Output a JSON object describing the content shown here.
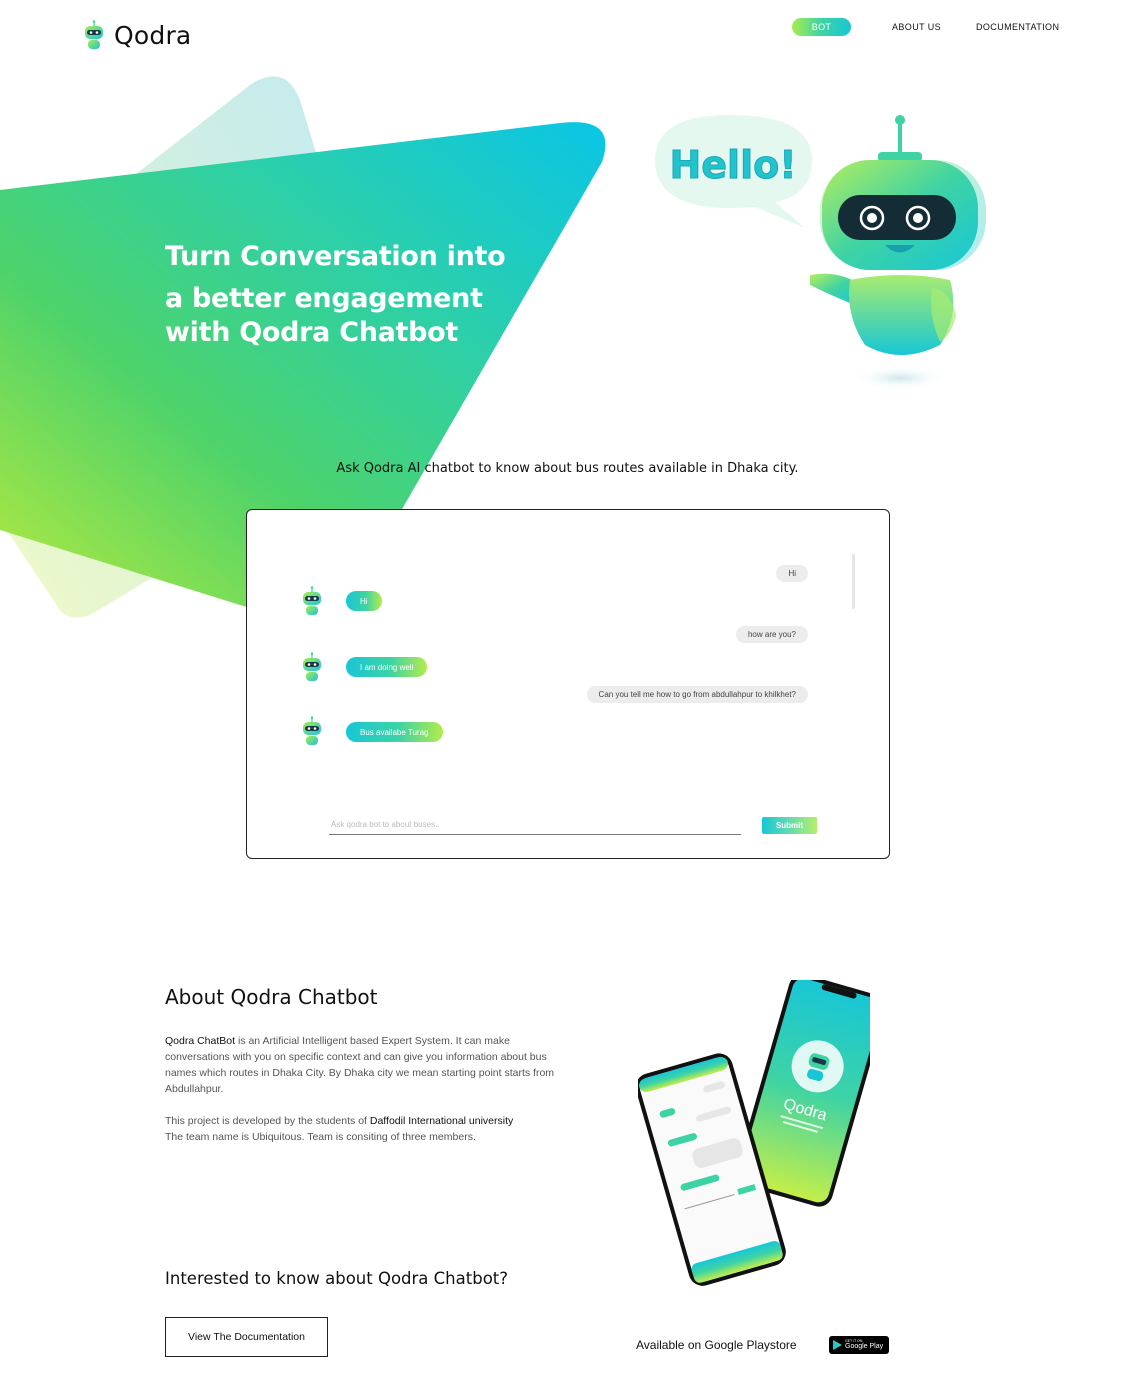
{
  "header": {
    "logo_text": "Qodra",
    "nav": [
      {
        "label": "BOT",
        "active": true
      },
      {
        "label": "ABOUT US",
        "active": false
      },
      {
        "label": "DOCUMENTATION",
        "active": false
      }
    ]
  },
  "hero": {
    "line1": "Turn Conversation into",
    "line2": "a better engagement",
    "line3": "with Qodra Chatbot",
    "bubble_text": "Hello!"
  },
  "subtitle": "Ask Qodra AI chatbot to know about bus routes available in Dhaka city.",
  "chat": {
    "messages": [
      {
        "from": "user",
        "text": "Hi"
      },
      {
        "from": "bot",
        "text": "Hi"
      },
      {
        "from": "user",
        "text": "how are you?"
      },
      {
        "from": "bot",
        "text": "I am doing well"
      },
      {
        "from": "user",
        "text": "Can you tell me how to go from abdullahpur to khilkhet?"
      },
      {
        "from": "bot",
        "text": "Bus availabe Turag"
      }
    ],
    "input_placeholder": "Ask qodra bot to about buses..",
    "submit_label": "Submit"
  },
  "about": {
    "title": "About Qodra Chatbot",
    "p1_bold": "Qodra ChatBot",
    "p1_rest": " is an Artificial Intelligent based Expert System. It can make conversations with you on specific context and can give you information about bus names which routes in Dhaka City. By Dhaka city we mean starting point starts from Abdullahpur.",
    "p2_start": "This project is developed by the students of ",
    "p2_bold": "Daffodil International university",
    "p2_rest": "The team name is Ubiquitous. Team is consiting of three members.",
    "phone_brand": "Qodra"
  },
  "cta": {
    "interested": "Interested to know about Qodra Chatbot?",
    "doc_button": "View The Documentation",
    "playstore_text": "Available on Google Playstore",
    "badge_small": "GET IT ON",
    "badge_big": "Google Play"
  },
  "colors": {
    "gradient_cyan": "#18c6d6",
    "gradient_mint": "#3ed3a4",
    "gradient_lime": "#a8ec50"
  }
}
